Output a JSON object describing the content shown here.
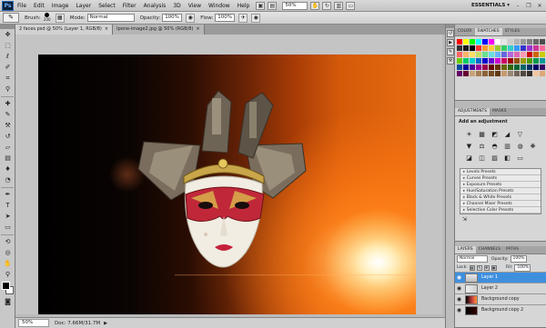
{
  "app": {
    "logo": "Ps"
  },
  "menu": [
    "File",
    "Edit",
    "Image",
    "Layer",
    "Select",
    "Filter",
    "Analysis",
    "3D",
    "View",
    "Window",
    "Help"
  ],
  "menubar_zoom": "50%",
  "workspace": "ESSENTIALS ▾",
  "options": {
    "brush_label": "Brush:",
    "brush_size": "200",
    "mode_label": "Mode:",
    "mode_value": "Normal",
    "opacity_label": "Opacity:",
    "opacity_value": "100%",
    "flow_label": "Flow:",
    "flow_value": "100%"
  },
  "tabs": [
    {
      "label": "2 faces.psd @ 50% (Layer 1, RGB/8)",
      "active": true
    },
    {
      "label": "Ipone-image2.jpg @ 50% (RGB/8)",
      "active": false
    }
  ],
  "status": {
    "zoom": "50%",
    "doc": "Doc: 7.66M/31.7M"
  },
  "color_panel": {
    "tabs": [
      "COLOR",
      "SWATCHES",
      "STYLES"
    ],
    "active_tab": "SWATCHES",
    "swatches": [
      "#ff0000",
      "#ffff00",
      "#00ff00",
      "#00ffff",
      "#0000ff",
      "#ff00ff",
      "#ffffff",
      "#e6e6e6",
      "#cccccc",
      "#b3b3b3",
      "#999999",
      "#808080",
      "#666666",
      "#4d4d4d",
      "#333333",
      "#1a1a1a",
      "#000000",
      "#ff3333",
      "#ff9933",
      "#ffcc33",
      "#99cc33",
      "#33cc66",
      "#33cccc",
      "#3399ff",
      "#3333cc",
      "#9933cc",
      "#cc3399",
      "#ff6699",
      "#ff6666",
      "#ffb366",
      "#ffe066",
      "#c2e066",
      "#66e08f",
      "#66e0e0",
      "#66b3ff",
      "#6666e0",
      "#b366e0",
      "#e066b3",
      "#ff99b3",
      "#cc0000",
      "#cc6600",
      "#cccc00",
      "#66cc00",
      "#00cc66",
      "#00cccc",
      "#0066cc",
      "#0000cc",
      "#6600cc",
      "#cc00cc",
      "#cc0066",
      "#990000",
      "#994d00",
      "#999900",
      "#4d9900",
      "#00994d",
      "#009999",
      "#004d99",
      "#000099",
      "#4d0099",
      "#990099",
      "#99004d",
      "#660000",
      "#663300",
      "#666600",
      "#336600",
      "#006633",
      "#006666",
      "#003366",
      "#000066",
      "#330066",
      "#660066",
      "#660033",
      "#c8a27a",
      "#a67c52",
      "#8c6239",
      "#754c24",
      "#603813",
      "#c69c6d",
      "#998675",
      "#736357",
      "#534741",
      "#362f2d",
      "#f2c6a0",
      "#e0a878"
    ]
  },
  "adjustments_panel": {
    "tabs": [
      "ADJUSTMENTS",
      "MASKS"
    ],
    "active_tab": "ADJUSTMENTS",
    "title": "Add an adjustment",
    "icons": [
      "☀",
      "▦",
      "◩",
      "◢",
      "▽",
      "",
      "▼",
      "⚖",
      "◓",
      "▥",
      "◍",
      "❋",
      "◪",
      "◫",
      "▨",
      "◧",
      "▭",
      ""
    ],
    "presets": [
      "Levels Presets",
      "Curves Presets",
      "Exposure Presets",
      "Hue/Saturation Presets",
      "Black & White Presets",
      "Channel Mixer Presets",
      "Selective Color Presets"
    ]
  },
  "layers_panel": {
    "tabs": [
      "LAYERS",
      "CHANNELS",
      "PATHS"
    ],
    "active_tab": "LAYERS",
    "blend_mode": "Normal",
    "opacity_label": "Opacity:",
    "opacity_value": "100%",
    "lock_label": "Lock:",
    "fill_label": "Fill:",
    "fill_value": "100%",
    "layers": [
      {
        "name": "Layer 1",
        "selected": true
      },
      {
        "name": "Layer 2",
        "selected": false
      },
      {
        "name": "Background copy",
        "selected": false
      },
      {
        "name": "Background copy 2",
        "selected": false
      }
    ]
  },
  "canvas": {
    "background_dark": "#000000",
    "glow_color": "#ff8a1a"
  }
}
